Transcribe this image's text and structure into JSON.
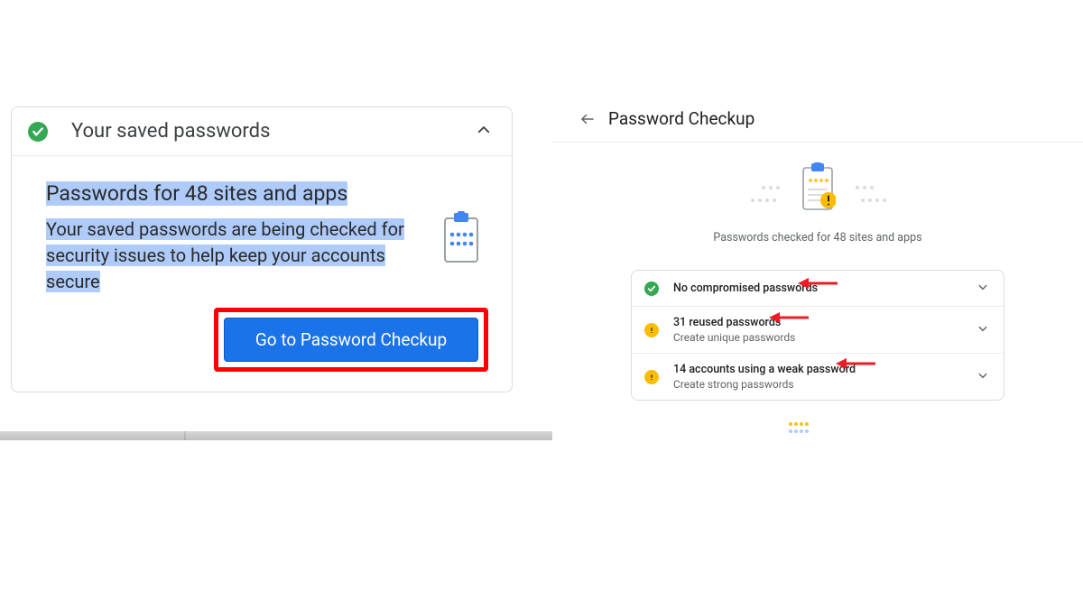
{
  "left": {
    "header_title": "Your saved passwords",
    "subtitle": "Passwords for 48 sites and apps",
    "description": "Your saved passwords are being checked for security issues to help keep your accounts secure",
    "button_label": "Go to Password Checkup"
  },
  "right": {
    "page_title": "Password Checkup",
    "checked_text": "Passwords checked for 48 sites and apps",
    "rows": [
      {
        "status": "ok",
        "title": "No compromised passwords",
        "sub": ""
      },
      {
        "status": "warn",
        "title": "31 reused passwords",
        "sub": "Create unique passwords"
      },
      {
        "status": "warn",
        "title": "14 accounts using a weak password",
        "sub": "Create strong passwords"
      }
    ]
  },
  "annotation": {
    "highlight_color": "#ff0000",
    "arrow_color": "#ec1c24"
  }
}
